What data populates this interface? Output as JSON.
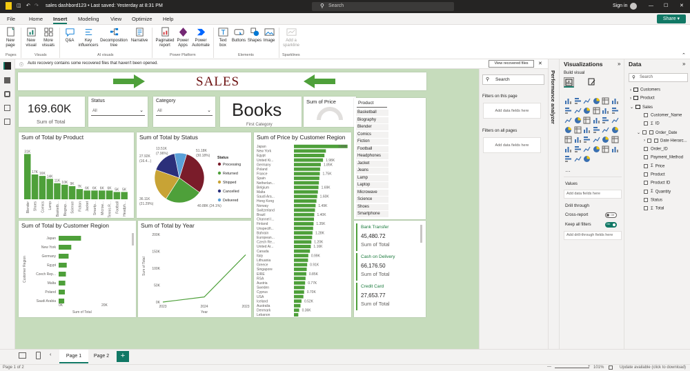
{
  "titlebar": {
    "title": "sales dashbord123 • Last saved: Yesterday at 8:31 PM",
    "search_placeholder": "Search",
    "user": "Sign in",
    "share": "Share"
  },
  "menu": [
    "File",
    "Home",
    "Insert",
    "Modeling",
    "View",
    "Optimize",
    "Help"
  ],
  "ribbon": {
    "buttons": [
      {
        "id": "new-page",
        "label": "New\npage"
      },
      {
        "id": "new-visual",
        "label": "New\nvisual"
      },
      {
        "id": "more-visuals",
        "label": "More\nvisuals"
      },
      {
        "id": "qa",
        "label": "Q&A"
      },
      {
        "id": "key-influencers",
        "label": "Key\ninfluencers"
      },
      {
        "id": "decomposition-tree",
        "label": "Decomposition\ntree"
      },
      {
        "id": "narrative",
        "label": "Narrative"
      },
      {
        "id": "paginated-report",
        "label": "Paginated\nreport"
      },
      {
        "id": "power-apps",
        "label": "Power\nApps"
      },
      {
        "id": "power-automate",
        "label": "Power\nAutomate"
      },
      {
        "id": "text-box",
        "label": "Text\nbox"
      },
      {
        "id": "buttons",
        "label": "Buttons"
      },
      {
        "id": "shapes",
        "label": "Shapes"
      },
      {
        "id": "image",
        "label": "Image"
      },
      {
        "id": "add-sparkline",
        "label": "Add a\nsparkline"
      }
    ],
    "groups": [
      "Pages",
      "Visuals",
      "AI visuals",
      "Power Platform",
      "Elements",
      "Sparklines"
    ]
  },
  "infobar": {
    "message": "Auto recovery contains some recovered files that haven't been opened.",
    "button": "View recovered files"
  },
  "report": {
    "title": "SALES",
    "kpi": {
      "value": "169.60K",
      "label": "Sum of Total"
    },
    "status_slicer": {
      "title": "Status",
      "value": "All"
    },
    "category_slicer": {
      "title": "Category",
      "value": "All"
    },
    "top_category": {
      "value": "Books",
      "label": "First Category"
    },
    "gauge": {
      "title": "Sum of Price"
    },
    "product_slicer": {
      "title": "Product",
      "items": [
        "Basketball",
        "Biography",
        "Blender",
        "Comics",
        "Fiction",
        "Football",
        "Headphones",
        "Jacket",
        "Jeans",
        "Lamp",
        "Laptop",
        "Microwave",
        "Science",
        "Shoes",
        "Smartphone"
      ]
    },
    "payment_cards": [
      {
        "method": "Bank Transfer",
        "value": "45,480.72",
        "label": "Sum of Total"
      },
      {
        "method": "Cash on Delivery",
        "value": "66,176.50",
        "label": "Sum of Total"
      },
      {
        "method": "Credit Card",
        "value": "27,653.77",
        "label": "Sum of Total"
      }
    ]
  },
  "colors": {
    "bar": "#4ea03a",
    "accent": "#1a7a3c",
    "title_red": "#6b0f0f",
    "canvas": "#c6dcbc"
  },
  "chart_data": [
    {
      "id": "by-product",
      "type": "bar",
      "title": "Sum of Total by Product",
      "categories": [
        "Blender",
        "Shoes",
        "Comics",
        "Lamp",
        "Basketball",
        "Biography",
        "Science",
        "Fiction",
        "Jacket",
        "Smartphone",
        "Microwave",
        "Tennis R...",
        "Football",
        "Headphones"
      ],
      "category_labels": [
        "Blender",
        "Shoes",
        "Comics",
        "Lamp",
        "Basketb...",
        "Biograp...",
        "Science",
        "Fiction",
        "Jacket",
        "Smartp...",
        "Microw...",
        "Tennis R...",
        "Football",
        "Headph..."
      ],
      "values": [
        31,
        17,
        16,
        14,
        11,
        10,
        9,
        7,
        6,
        6,
        6,
        6,
        5,
        5
      ],
      "data_labels": [
        "31K",
        "17K",
        "16K",
        "14K",
        "11K",
        "10K",
        "9K",
        "7K",
        "6K",
        "6K",
        "6K",
        "6K",
        "5K",
        "5K"
      ],
      "ylim": [
        0,
        34
      ]
    },
    {
      "id": "by-status",
      "type": "pie",
      "title": "Sum of Total by Status",
      "legend_title": "Status",
      "slices": [
        {
          "name": "Processing",
          "value": 51.18,
          "pct": "30.18%",
          "label": "51.18K (30.18%)",
          "color": "#7a1c2a"
        },
        {
          "name": "Returned",
          "value": 40.88,
          "pct": "24.1%",
          "label": "40.88K (24.1%)",
          "color": "#4ea03a"
        },
        {
          "name": "Shipped",
          "value": 36.11,
          "pct": "21.29%",
          "label": "36.11K (21.29%)",
          "color": "#c8a335"
        },
        {
          "name": "Cancelled",
          "value": 27.92,
          "pct": "16.4...",
          "label": "27.92K (16.4...)",
          "color": "#2b2f7a"
        },
        {
          "name": "Delivered",
          "value": 13.51,
          "pct": "7.96%",
          "label": "13.51K (7.96%)",
          "color": "#5aa0d8"
        }
      ]
    },
    {
      "id": "price-by-region",
      "type": "bar",
      "title": "Sum of Price by Customer Region",
      "categories": [
        "Japan",
        "New York",
        "Egypt",
        "United Ki...",
        "Germany",
        "Poland",
        "France",
        "Spain",
        "Netherlan...",
        "Belgium",
        "Malta",
        "Saudi Ara...",
        "Hong Kong",
        "Norway",
        "Switzerland",
        "Brazil",
        "Channel I...",
        "Finland",
        "Unspecifi...",
        "Bahrain",
        "European...",
        "Czech Re...",
        "United Ar...",
        "Canada",
        "Italy",
        "Lithuania",
        "Greece",
        "Singapore",
        "EIRE",
        "RSA",
        "Austria",
        "Sweden",
        "Cyprus",
        "USA",
        "Iceland",
        "Australia",
        "Denmark",
        "Lebanon"
      ],
      "values": [
        3.69,
        2.2,
        2.1,
        2.0,
        1.85,
        1.8,
        1.78,
        1.75,
        1.72,
        1.69,
        1.65,
        1.6,
        1.55,
        1.49,
        1.45,
        1.4,
        1.38,
        1.35,
        1.32,
        1.28,
        1.25,
        1.2,
        1.16,
        1.1,
        0.99,
        0.97,
        0.91,
        0.88,
        0.85,
        0.8,
        0.77,
        0.74,
        0.7,
        0.65,
        0.52,
        0.45,
        0.36,
        0.3
      ],
      "data_labels": {
        "0": "3.69K",
        "3": "1.98K",
        "4": "1.85K",
        "6": "1.75K",
        "9": "1.69K",
        "11": "1.60K",
        "13": "1.49K",
        "15": "1.40K",
        "17": "1.35K",
        "19": "1.28K",
        "21": "1.20K",
        "22": "1.16K",
        "24": "0.99K",
        "26": "0.91K",
        "28": "0.85K",
        "30": "0.77K",
        "32": "0.70K",
        "34": "0.52K",
        "36": "0.36K"
      },
      "xlim": [
        0,
        3.8
      ]
    },
    {
      "id": "by-region",
      "type": "bar",
      "title": "Sum of Total by Customer Region",
      "categories": [
        "Japan",
        "New York",
        "Germany",
        "Egypt",
        "Czech Rep...",
        "Malta",
        "Poland",
        "Saudi Arabia"
      ],
      "values": [
        10.8,
        6.1,
        4.8,
        3.9,
        3.5,
        3.2,
        3.0,
        2.7
      ],
      "xlabel": "Sum of Total",
      "ylabel": "Customer Region",
      "xticks": [
        "0K",
        "20K"
      ],
      "xlim": [
        0,
        22
      ]
    },
    {
      "id": "by-year",
      "type": "line",
      "title": "Sum of Total by Year",
      "x": [
        "2023",
        "2024",
        "2023"
      ],
      "values": [
        0,
        15,
        140
      ],
      "ylabel": "Sum of Total",
      "xlabel": "Year",
      "yticks": [
        "0K",
        "50K",
        "100K",
        "150K",
        "200K"
      ],
      "ylim": [
        0,
        200
      ]
    }
  ],
  "filters": {
    "search": "Search",
    "on_page": "Filters on this page",
    "on_all": "Filters on all pages",
    "add_fields": "Add data fields here"
  },
  "perf_label": "Performance analyzer",
  "viz": {
    "title": "Visualizations",
    "build": "Build visual",
    "values": "Values",
    "add_fields": "Add data fields here",
    "drill": "Drill through",
    "cross_report": "Cross-report",
    "cross_state": "Off",
    "keep_filters": "Keep all filters",
    "keep_state": "On",
    "add_drill": "Add drill-through fields here"
  },
  "data_pane": {
    "title": "Data",
    "search": "Search",
    "tables": [
      "Customers",
      "Product",
      "Sales"
    ],
    "fields": [
      "Customer_Name",
      "ID",
      "Order_Date",
      "Date Hierarc...",
      "Order_ID",
      "Payment_Method",
      "Price",
      "Product",
      "Product ID",
      "Quantity",
      "Status",
      "Total"
    ]
  },
  "pages": [
    "Page 1",
    "Page 2"
  ],
  "add_page": "+",
  "status": {
    "left": "Page 1 of 2",
    "zoom": "101%",
    "update": "Update available (click to download)"
  }
}
